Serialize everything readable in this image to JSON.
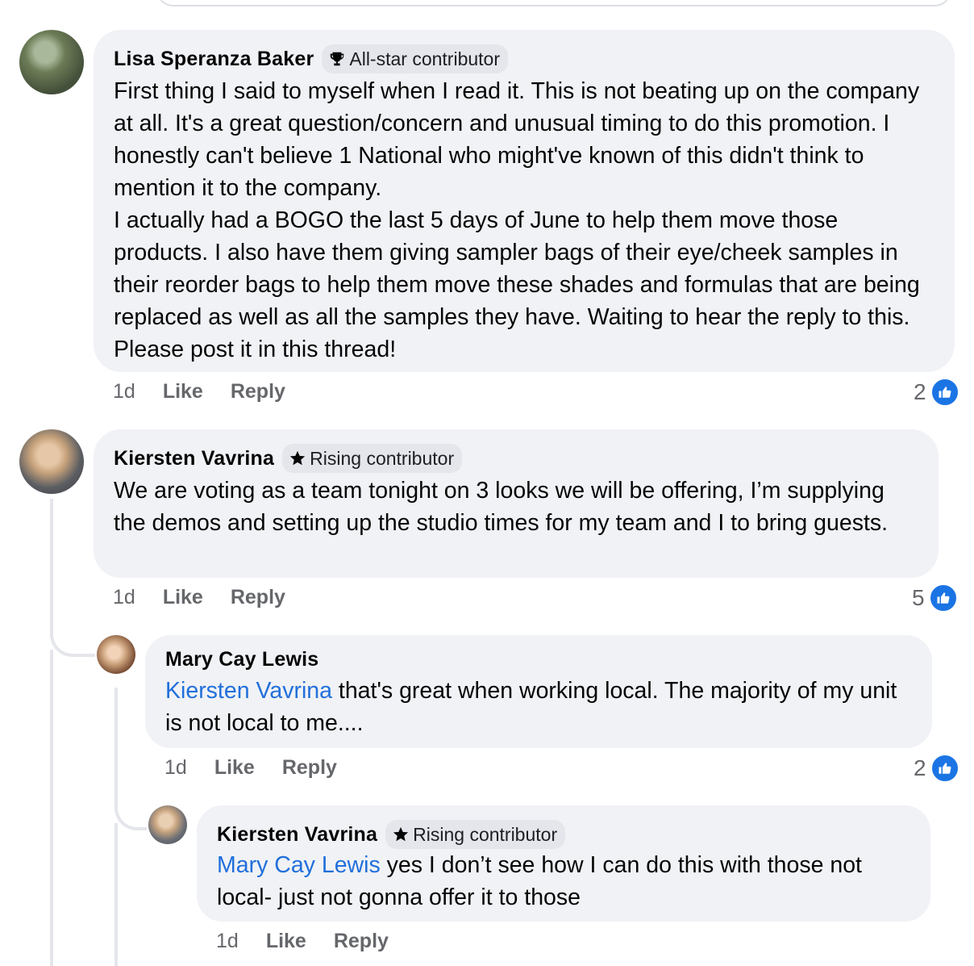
{
  "comments": [
    {
      "author": "Lisa Speranza Baker",
      "badge": "All-star contributor",
      "badge_icon": "trophy-icon",
      "paragraphs": [
        "First thing I said to myself when I read it. This is not beating up on the company at all. It's a great question/concern and unusual timing to do this promotion. I honestly can't believe 1 National who might've known of this didn't think to mention it to the company.",
        "I actually had a BOGO the last 5 days of June to help them move those products. I also have them giving sampler bags of their eye/cheek samples in their reorder bags to help them move these shades and formulas that are being replaced as well as all the samples they have. Waiting to hear the reply to this. Please post it in this thread!"
      ],
      "time": "1d",
      "like_label": "Like",
      "reply_label": "Reply",
      "reaction_count": "2"
    },
    {
      "author": "Kiersten Vavrina",
      "badge": "Rising contributor",
      "badge_icon": "star-icon",
      "text": "We are voting as a team tonight on 3 looks we will be offering,  I’m supplying the demos and setting up the studio times for my team and I to bring guests.",
      "time": "1d",
      "like_label": "Like",
      "reply_label": "Reply",
      "reaction_count": "5"
    },
    {
      "author": "Mary Cay Lewis",
      "mention": "Kiersten Vavrina",
      "text": " that's great when working local. The majority of my unit is not local to me....",
      "time": "1d",
      "like_label": "Like",
      "reply_label": "Reply",
      "reaction_count": "2"
    },
    {
      "author": "Kiersten Vavrina",
      "badge": "Rising contributor",
      "badge_icon": "star-icon",
      "mention": "Mary Cay Lewis",
      "text": " yes I don’t see how I can do this with those not local- just not gonna offer it to those",
      "time": "1d",
      "like_label": "Like",
      "reply_label": "Reply"
    }
  ],
  "colors": {
    "bubble": "#f0f2f5",
    "mention": "#216fdb",
    "secondary_text": "#65676b",
    "like_blue": "#1b74e4"
  }
}
